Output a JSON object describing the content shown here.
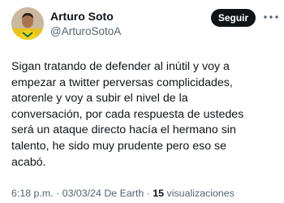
{
  "author": {
    "display_name": "Arturo Soto",
    "handle": "@ArturoSotoA"
  },
  "follow_button": {
    "label": "Seguir"
  },
  "more_icon": "ellipsis-icon",
  "tweet": {
    "lines": [
      "Sigan tratando de defender al inútil y voy a",
      "empezar a twitter perversas complicidades,",
      "atorenle y voy a subir el nivel de la",
      "conversación, por cada respuesta de ustedes",
      "será un ataque directo hacía el hermano sin",
      "talento, he sido muy prudente pero eso se",
      "acabó."
    ]
  },
  "meta": {
    "time": "6:18 p.m.",
    "separator": " · ",
    "date": "03/03/24",
    "source": "De Earth",
    "views_count": "15",
    "views_label": "visualizaciones"
  },
  "colors": {
    "text": "#0f1419",
    "secondary": "#536471",
    "button_bg": "#0f1419",
    "button_text": "#ffffff"
  }
}
